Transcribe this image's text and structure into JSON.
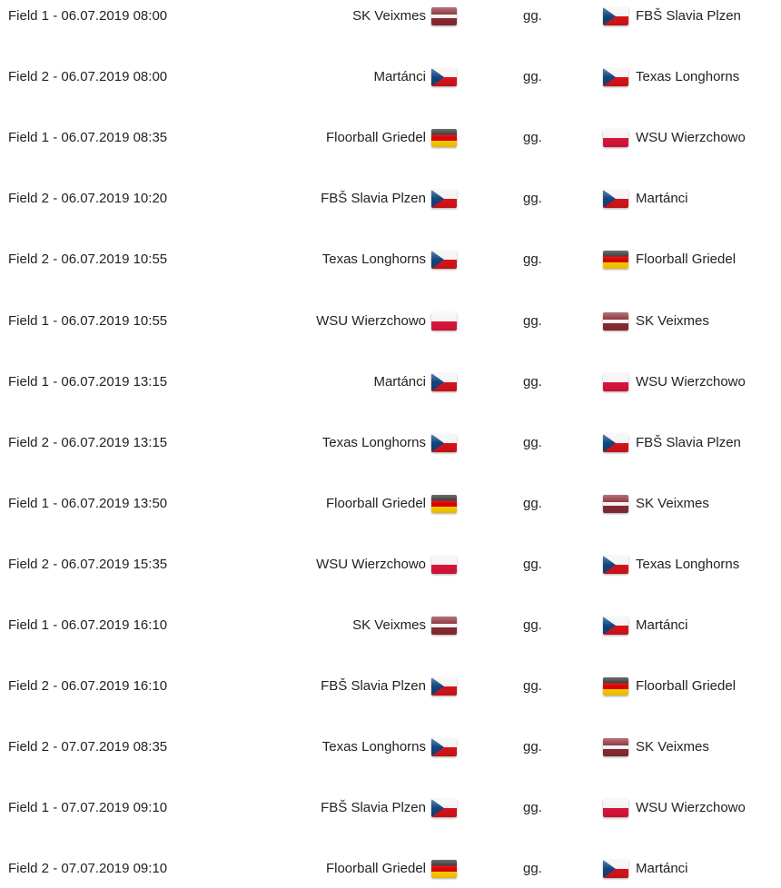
{
  "flag_colors": {
    "cz": [
      "#11457e",
      "#f4f4f4",
      "#d7141a"
    ],
    "lv": [
      "#8a2a33",
      "#f4f4f4"
    ],
    "de": [
      "#222222",
      "#dd0000",
      "#ffce00"
    ],
    "pl": [
      "#f4f4f4",
      "#dc143c"
    ]
  },
  "matches": [
    {
      "time": "Field 1 - 06.07.2019 08:00",
      "home": "SK Veixmes",
      "home_flag": "lv",
      "result": "gg.",
      "away": "FBŠ Slavia Plzen",
      "away_flag": "cz"
    },
    {
      "time": "Field 2 - 06.07.2019 08:00",
      "home": "Martánci",
      "home_flag": "cz",
      "result": "gg.",
      "away": "Texas Longhorns",
      "away_flag": "cz"
    },
    {
      "time": "Field 1 - 06.07.2019 08:35",
      "home": "Floorball Griedel",
      "home_flag": "de",
      "result": "gg.",
      "away": "WSU Wierzchowo",
      "away_flag": "pl"
    },
    {
      "time": "Field 2 - 06.07.2019 10:20",
      "home": "FBŠ Slavia Plzen",
      "home_flag": "cz",
      "result": "gg.",
      "away": "Martánci",
      "away_flag": "cz"
    },
    {
      "time": "Field 2 - 06.07.2019 10:55",
      "home": "Texas Longhorns",
      "home_flag": "cz",
      "result": "gg.",
      "away": "Floorball Griedel",
      "away_flag": "de"
    },
    {
      "time": "Field 1 - 06.07.2019 10:55",
      "home": "WSU Wierzchowo",
      "home_flag": "pl",
      "result": "gg.",
      "away": "SK Veixmes",
      "away_flag": "lv"
    },
    {
      "time": "Field 1 - 06.07.2019 13:15",
      "home": "Martánci",
      "home_flag": "cz",
      "result": "gg.",
      "away": "WSU Wierzchowo",
      "away_flag": "pl"
    },
    {
      "time": "Field 2 - 06.07.2019 13:15",
      "home": "Texas Longhorns",
      "home_flag": "cz",
      "result": "gg.",
      "away": "FBŠ Slavia Plzen",
      "away_flag": "cz"
    },
    {
      "time": "Field 1 - 06.07.2019 13:50",
      "home": "Floorball Griedel",
      "home_flag": "de",
      "result": "gg.",
      "away": "SK Veixmes",
      "away_flag": "lv"
    },
    {
      "time": "Field 2 - 06.07.2019 15:35",
      "home": "WSU Wierzchowo",
      "home_flag": "pl",
      "result": "gg.",
      "away": "Texas Longhorns",
      "away_flag": "cz"
    },
    {
      "time": "Field 1 - 06.07.2019 16:10",
      "home": "SK Veixmes",
      "home_flag": "lv",
      "result": "gg.",
      "away": "Martánci",
      "away_flag": "cz"
    },
    {
      "time": "Field 2 - 06.07.2019 16:10",
      "home": "FBŠ Slavia Plzen",
      "home_flag": "cz",
      "result": "gg.",
      "away": "Floorball Griedel",
      "away_flag": "de"
    },
    {
      "time": "Field 2 - 07.07.2019 08:35",
      "home": "Texas Longhorns",
      "home_flag": "cz",
      "result": "gg.",
      "away": "SK Veixmes",
      "away_flag": "lv"
    },
    {
      "time": "Field 1 - 07.07.2019 09:10",
      "home": "FBŠ Slavia Plzen",
      "home_flag": "cz",
      "result": "gg.",
      "away": "WSU Wierzchowo",
      "away_flag": "pl"
    },
    {
      "time": "Field 2 - 07.07.2019 09:10",
      "home": "Floorball Griedel",
      "home_flag": "de",
      "result": "gg.",
      "away": "Martánci",
      "away_flag": "cz"
    }
  ]
}
